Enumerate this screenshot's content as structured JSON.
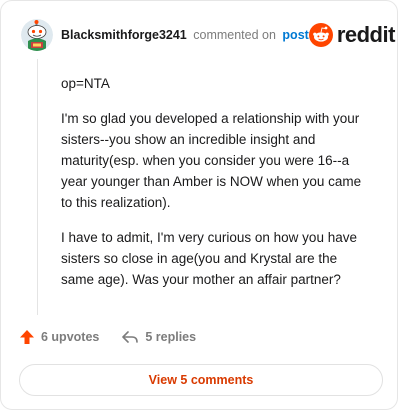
{
  "comment": {
    "username": "Blacksmithforge3241",
    "action_text": "commented on",
    "post_link": "post",
    "paragraphs": [
      "op=NTA",
      "I'm so glad you developed a relationship with your sisters--you show an incredible insight and maturity(esp. when you consider you were 16--a year younger than Amber is NOW when you came to this realization).",
      "I have to admit, I'm very curious on how you have sisters so close in age(you and Krystal are the same age). Was your mother an affair partner?"
    ]
  },
  "brand": {
    "name": "reddit",
    "color": "#ff4500"
  },
  "actions": {
    "upvotes": "6 upvotes",
    "replies": "5 replies",
    "upvote_color": "#ff4500"
  },
  "footer": {
    "view_comments": "View 5 comments",
    "accent_color": "#d93a00"
  }
}
